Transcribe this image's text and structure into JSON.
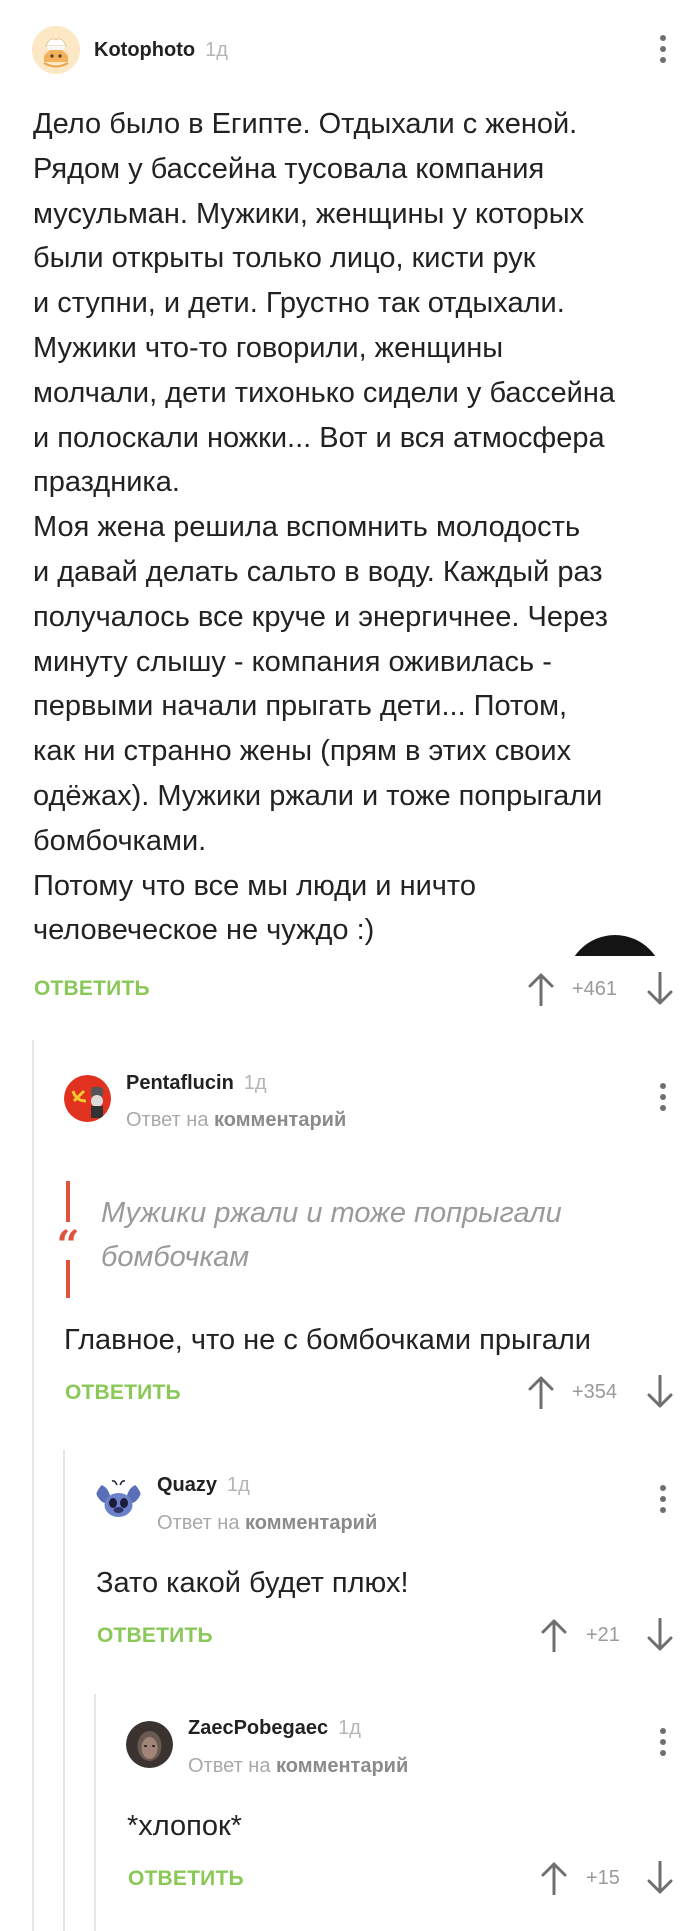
{
  "main_comment": {
    "author": "Kotophoto",
    "time": "1д",
    "lines": [
      "Дело было в Египте. Отдыхали с женой.",
      "Рядом у бассейна тусовала компания",
      "мусульман. Мужики, женщины у которых",
      "были открыты только лицо, кисти рук",
      "и ступни, и дети. Грустно так отдыхали.",
      "Мужики что-то говорили, женщины",
      "молчали, дети тихонько сидели у бассейна",
      "и полоскали ножки... Вот и вся атмосфера",
      "праздника.",
      "Моя жена решила вспомнить молодость",
      "и давай делать сальто в воду. Каждый раз",
      "получалось все круче и энергичнее. Через",
      "минуту слышу - компания оживилась -",
      "первыми начали прыгать дети... Потом,",
      "как ни странно жены (прям в этих своих",
      "одёжах). Мужики ржали и тоже попрыгали",
      "бомбочками.",
      "Потому что все мы люди и ничто",
      "человеческое не чуждо :)"
    ],
    "reply_label": "ОТВЕТИТЬ",
    "score": "+461"
  },
  "reply_1": {
    "author": "Pentaflucin",
    "time": "1д",
    "reply_prefix": "Ответ на",
    "reply_target": "комментарий",
    "quote_mark": "“",
    "quote": "Мужики ржали и тоже попрыгали\nбомбочкам",
    "text": "Главное, что не с бомбочками прыгали",
    "reply_label": "ОТВЕТИТЬ",
    "score": "+354"
  },
  "reply_2": {
    "author": "Quazy",
    "time": "1д",
    "reply_prefix": "Ответ на",
    "reply_target": "комментарий",
    "text": "Зато какой будет плюх!",
    "reply_label": "ОТВЕТИТЬ",
    "score": "+21"
  },
  "reply_3": {
    "author": "ZaecPobegaec",
    "time": "1д",
    "reply_prefix": "Ответ на",
    "reply_target": "комментарий",
    "text": "*хлопок*",
    "reply_label": "ОТВЕТИТЬ",
    "score": "+15"
  },
  "colors": {
    "accent_green": "#8ac858",
    "quote_red": "#e0533c",
    "thread_line": "#e6e6e6"
  },
  "icons": [
    "cat-cook-avatar-icon",
    "hammer-sickle-avatar-icon",
    "stitch-avatar-icon",
    "user-photo-avatar-icon",
    "more-vertical-icon",
    "arrow-up-icon",
    "arrow-down-icon",
    "quote-icon"
  ]
}
